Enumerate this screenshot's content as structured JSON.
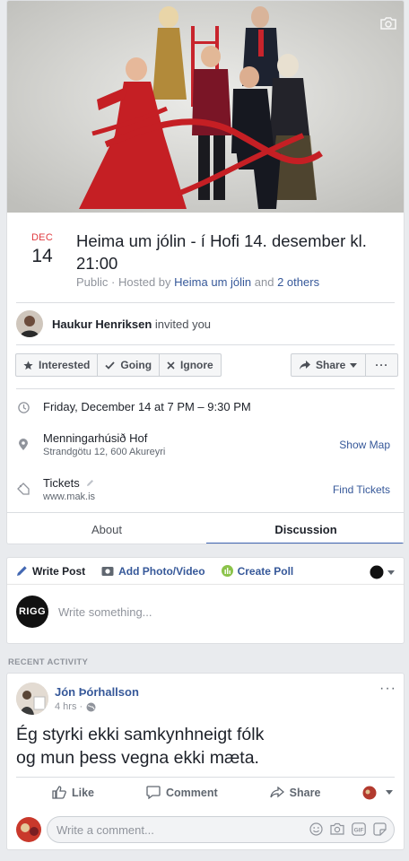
{
  "event": {
    "date_month": "DEC",
    "date_day": "14",
    "title": "Heima um jólin - í Hofi 14. desember kl. 21:00",
    "privacy": "Public",
    "hosted_by_prefix": "· Hosted by",
    "host_name": "Heima um jólin",
    "and_text": "and",
    "others_link": "2 others"
  },
  "invite": {
    "inviter": "Haukur Henriksen",
    "suffix": "invited you"
  },
  "rsvp": {
    "interested": "Interested",
    "going": "Going",
    "ignore": "Ignore",
    "share": "Share",
    "more": "···"
  },
  "details": {
    "time": "Friday, December 14 at 7 PM – 9:30 PM",
    "venue": "Menningarhúsið Hof",
    "address": "Strandgötu 12, 600 Akureyri",
    "show_map": "Show Map",
    "tickets_label": "Tickets",
    "tickets_url": "www.mak.is",
    "find_tickets": "Find Tickets"
  },
  "tabs": {
    "about": "About",
    "discussion": "Discussion"
  },
  "composer": {
    "write_post": "Write Post",
    "add_photo": "Add Photo/Video",
    "create_poll": "Create Poll",
    "avatar_text": "RIGG",
    "placeholder": "Write something..."
  },
  "activity": {
    "section_label": "RECENT ACTIVITY",
    "author": "Jón Þórhallson",
    "time": "4 hrs ·",
    "body_line1": "Ég styrki ekki samkynhneigt fólk",
    "body_line2": "og mun þess vegna ekki mæta.",
    "like": "Like",
    "comment": "Comment",
    "share": "Share",
    "comment_placeholder": "Write a comment...",
    "more": "···"
  },
  "colors": {
    "accent": "#4267b2",
    "link": "#365899",
    "date_red": "#e0393e"
  }
}
